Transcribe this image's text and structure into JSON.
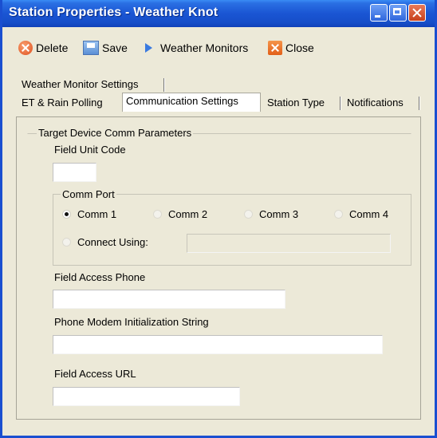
{
  "window": {
    "title": "Station Properties - Weather Knot"
  },
  "toolbar": {
    "delete_label": "Delete",
    "save_label": "Save",
    "monitors_label": "Weather Monitors",
    "close_label": "Close"
  },
  "tabs": {
    "row1": [
      "Weather Monitor Settings"
    ],
    "row2": [
      "ET & Rain Polling",
      "Communication Settings",
      "Station Type",
      "Notifications"
    ],
    "active": "Communication Settings"
  },
  "panel": {
    "group_title": "Target Device Comm Parameters",
    "field_unit_code": {
      "label": "Field Unit Code",
      "value": ""
    },
    "comm_port": {
      "title": "Comm Port",
      "options": [
        "Comm 1",
        "Comm 2",
        "Comm 3",
        "Comm 4"
      ],
      "selected": "Comm 1",
      "connect_using_label": "Connect Using:",
      "connect_using_value": ""
    },
    "field_access_phone": {
      "label": "Field Access Phone",
      "value": ""
    },
    "modem_init": {
      "label": "Phone Modem Initialization String",
      "value": ""
    },
    "field_access_url": {
      "label": "Field Access URL",
      "value": ""
    }
  }
}
